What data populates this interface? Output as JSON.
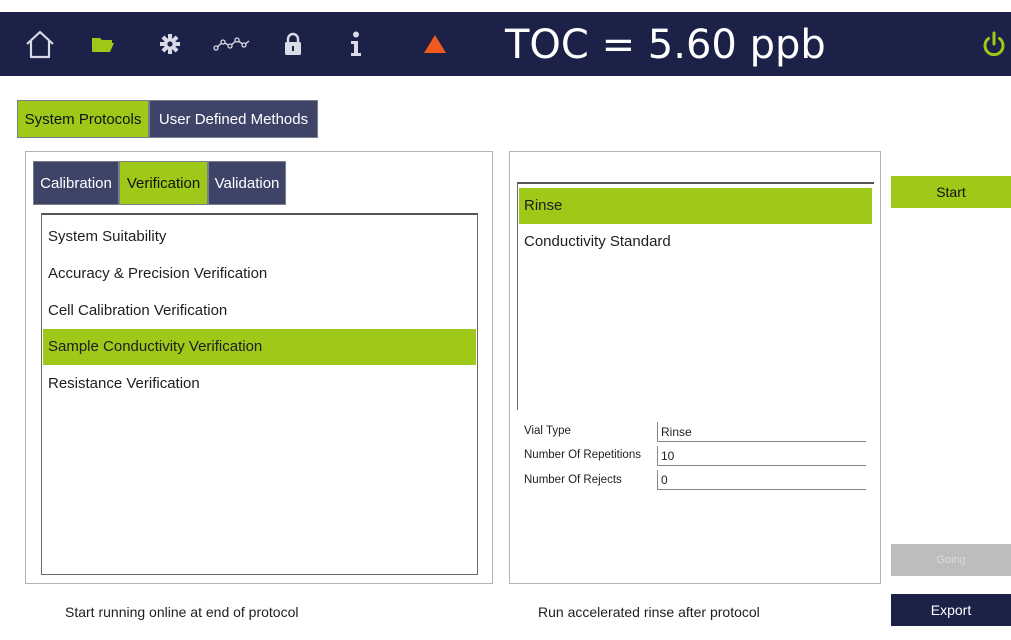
{
  "header": {
    "toc_reading": "TOC = 5.60 ppb",
    "icons": [
      "home-icon",
      "folder-icon",
      "gear-icon",
      "trend-icon",
      "lock-icon",
      "info-icon",
      "warning-icon",
      "power-icon"
    ],
    "colors": {
      "bar": "#1b2147",
      "accent": "#9fc919",
      "warning": "#f05a1e",
      "power": "#9fc919"
    }
  },
  "protocol_tabs": [
    {
      "label": "System Protocols",
      "active": true
    },
    {
      "label": "User Defined Methods",
      "active": false
    }
  ],
  "sub_tabs": [
    {
      "label": "Calibration",
      "active": false
    },
    {
      "label": "Verification",
      "active": true
    },
    {
      "label": "Validation",
      "active": false
    }
  ],
  "protocols": [
    {
      "label": "System Suitability",
      "selected": false
    },
    {
      "label": "Accuracy & Precision Verification",
      "selected": false
    },
    {
      "label": "Cell Calibration Verification",
      "selected": false
    },
    {
      "label": "Sample Conductivity Verification",
      "selected": true
    },
    {
      "label": "Resistance Verification",
      "selected": false
    }
  ],
  "steps": [
    {
      "label": "Rinse",
      "selected": true
    },
    {
      "label": "Conductivity Standard",
      "selected": false
    }
  ],
  "step_details": {
    "vial_type_label": "Vial Type",
    "vial_type_value": "Rinse",
    "repetitions_label": "Number Of Repetitions",
    "repetitions_value": "10",
    "rejects_label": "Number Of Rejects",
    "rejects_value": "0"
  },
  "buttons": {
    "start": "Start",
    "disabled_label": "Going",
    "export": "Export"
  },
  "footer": {
    "online_text": "Start running online at end of protocol",
    "rinse_text": "Run accelerated rinse after protocol"
  }
}
